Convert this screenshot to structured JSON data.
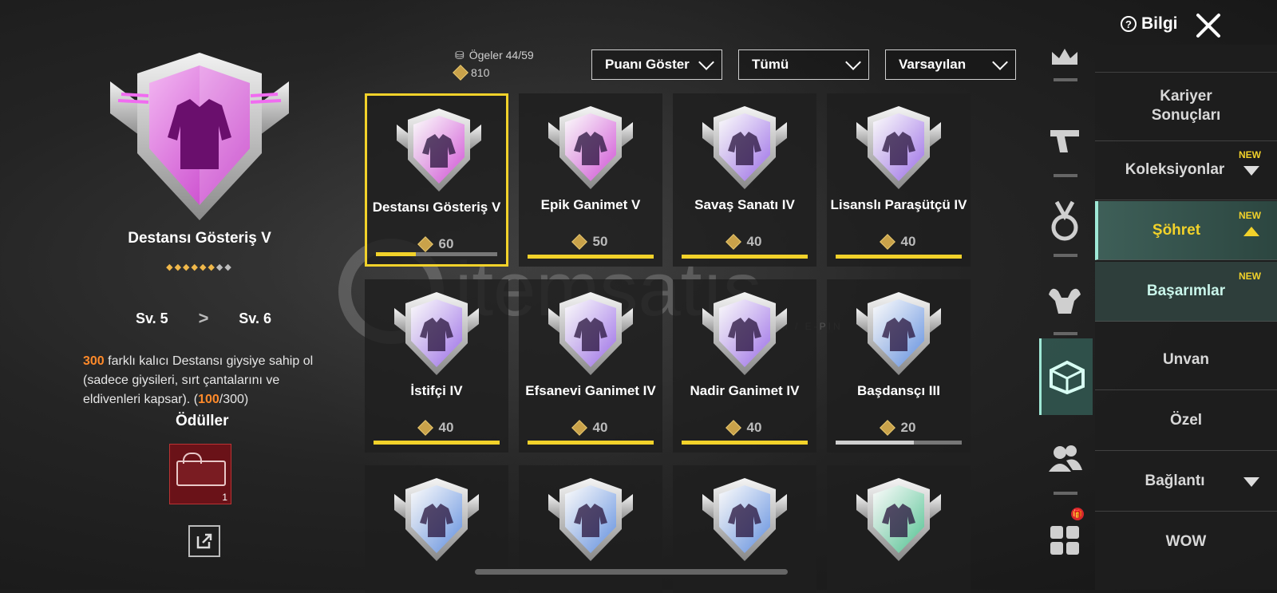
{
  "header": {
    "info_label": "Bilgi"
  },
  "detail": {
    "title": "Destansı Gösteriş V",
    "level_from": "Sv. 5",
    "level_to": "Sv. 6",
    "desc_highlight": "300",
    "desc_text": " farklı kalıcı Destansı giysiye sahip ol (sadece giysileri, sırt çantalarını ve eldivenleri kapsar). (",
    "progress_current": "100",
    "progress_rest": "/300)",
    "rewards_title": "Ödüller",
    "reward_count": "1",
    "stars_filled": 6,
    "stars_total": 8
  },
  "stats": {
    "items_label": "Ögeler  44/59",
    "points": "810"
  },
  "filters": {
    "score": "Puanı Göster",
    "category": "Tümü",
    "sort": "Varsayılan"
  },
  "achievements": [
    {
      "name": "Destansı Gösteriş V",
      "points": "60",
      "progress": 0.33,
      "selected": true,
      "color": "#d14fd6"
    },
    {
      "name": "Epik Ganimet V",
      "points": "50",
      "progress": 1,
      "color": "#d14fd6"
    },
    {
      "name": "Savaş Sanatı IV",
      "points": "40",
      "progress": 1,
      "color": "#9b6ce8"
    },
    {
      "name": "Lisanslı Paraşütçü IV",
      "points": "40",
      "progress": 1,
      "color": "#9b6ce8"
    },
    {
      "name": "İstifçi IV",
      "points": "40",
      "progress": 1,
      "color": "#9b6ce8"
    },
    {
      "name": "Efsanevi Ganimet IV",
      "points": "40",
      "progress": 1,
      "color": "#9b6ce8"
    },
    {
      "name": "Nadir Ganimet IV",
      "points": "40",
      "progress": 1,
      "color": "#9b6ce8"
    },
    {
      "name": "Başdansçı III",
      "points": "20",
      "progress": 0.62,
      "white": true,
      "color": "#5f8ee0"
    },
    {
      "name": "",
      "points": "",
      "color": "#5f8ee0"
    },
    {
      "name": "",
      "points": "",
      "color": "#5f8ee0"
    },
    {
      "name": "",
      "points": "",
      "color": "#5f8ee0"
    },
    {
      "name": "",
      "points": "",
      "color": "#4fc290"
    }
  ],
  "menu": {
    "career": "Kariyer\nSonuçları",
    "collections": "Koleksiyonlar",
    "fame": "Şöhret",
    "achievements": "Başarımlar",
    "title": "Unvan",
    "special": "Özel",
    "connection": "Bağlantı",
    "wow": "WOW",
    "new_label": "NEW"
  },
  "watermark": {
    "brand": "itemsatış",
    "tagline": "SKIN / ITEM / E-PIN"
  }
}
